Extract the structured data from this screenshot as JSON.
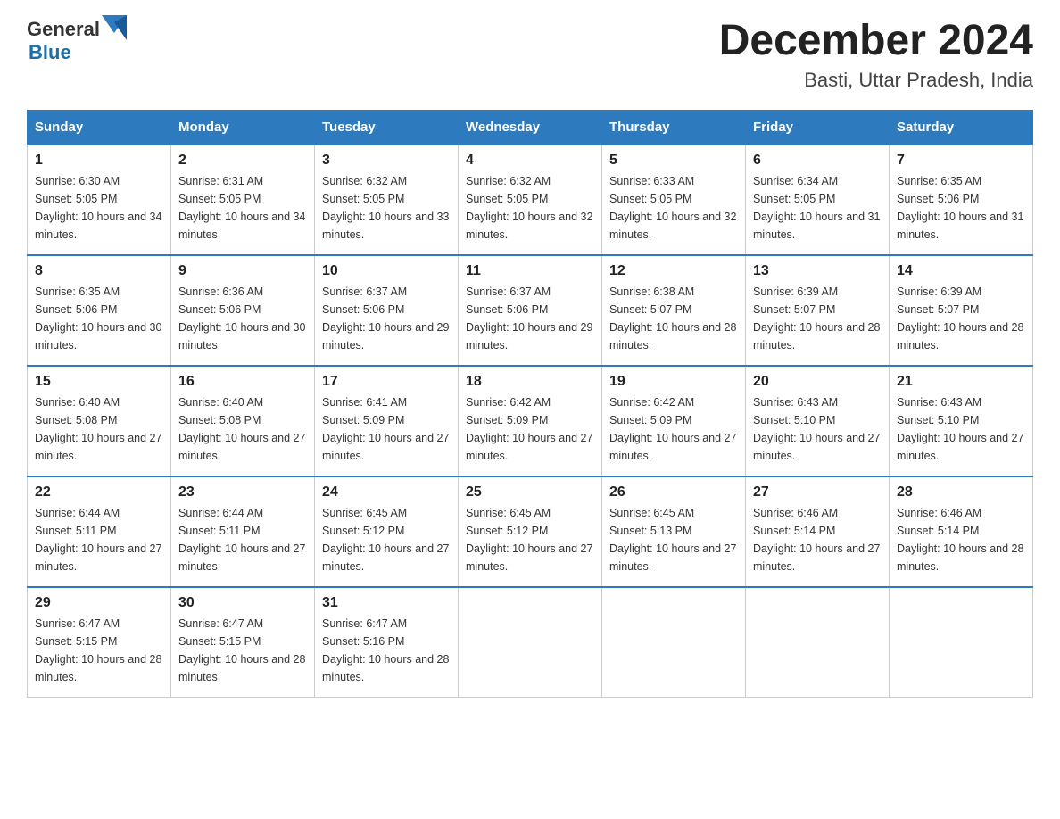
{
  "header": {
    "logo_general": "General",
    "logo_blue": "Blue",
    "title": "December 2024",
    "subtitle": "Basti, Uttar Pradesh, India"
  },
  "calendar": {
    "weekdays": [
      "Sunday",
      "Monday",
      "Tuesday",
      "Wednesday",
      "Thursday",
      "Friday",
      "Saturday"
    ],
    "weeks": [
      [
        {
          "day": "1",
          "sunrise": "6:30 AM",
          "sunset": "5:05 PM",
          "daylight": "10 hours and 34 minutes."
        },
        {
          "day": "2",
          "sunrise": "6:31 AM",
          "sunset": "5:05 PM",
          "daylight": "10 hours and 34 minutes."
        },
        {
          "day": "3",
          "sunrise": "6:32 AM",
          "sunset": "5:05 PM",
          "daylight": "10 hours and 33 minutes."
        },
        {
          "day": "4",
          "sunrise": "6:32 AM",
          "sunset": "5:05 PM",
          "daylight": "10 hours and 32 minutes."
        },
        {
          "day": "5",
          "sunrise": "6:33 AM",
          "sunset": "5:05 PM",
          "daylight": "10 hours and 32 minutes."
        },
        {
          "day": "6",
          "sunrise": "6:34 AM",
          "sunset": "5:05 PM",
          "daylight": "10 hours and 31 minutes."
        },
        {
          "day": "7",
          "sunrise": "6:35 AM",
          "sunset": "5:06 PM",
          "daylight": "10 hours and 31 minutes."
        }
      ],
      [
        {
          "day": "8",
          "sunrise": "6:35 AM",
          "sunset": "5:06 PM",
          "daylight": "10 hours and 30 minutes."
        },
        {
          "day": "9",
          "sunrise": "6:36 AM",
          "sunset": "5:06 PM",
          "daylight": "10 hours and 30 minutes."
        },
        {
          "day": "10",
          "sunrise": "6:37 AM",
          "sunset": "5:06 PM",
          "daylight": "10 hours and 29 minutes."
        },
        {
          "day": "11",
          "sunrise": "6:37 AM",
          "sunset": "5:06 PM",
          "daylight": "10 hours and 29 minutes."
        },
        {
          "day": "12",
          "sunrise": "6:38 AM",
          "sunset": "5:07 PM",
          "daylight": "10 hours and 28 minutes."
        },
        {
          "day": "13",
          "sunrise": "6:39 AM",
          "sunset": "5:07 PM",
          "daylight": "10 hours and 28 minutes."
        },
        {
          "day": "14",
          "sunrise": "6:39 AM",
          "sunset": "5:07 PM",
          "daylight": "10 hours and 28 minutes."
        }
      ],
      [
        {
          "day": "15",
          "sunrise": "6:40 AM",
          "sunset": "5:08 PM",
          "daylight": "10 hours and 27 minutes."
        },
        {
          "day": "16",
          "sunrise": "6:40 AM",
          "sunset": "5:08 PM",
          "daylight": "10 hours and 27 minutes."
        },
        {
          "day": "17",
          "sunrise": "6:41 AM",
          "sunset": "5:09 PM",
          "daylight": "10 hours and 27 minutes."
        },
        {
          "day": "18",
          "sunrise": "6:42 AM",
          "sunset": "5:09 PM",
          "daylight": "10 hours and 27 minutes."
        },
        {
          "day": "19",
          "sunrise": "6:42 AM",
          "sunset": "5:09 PM",
          "daylight": "10 hours and 27 minutes."
        },
        {
          "day": "20",
          "sunrise": "6:43 AM",
          "sunset": "5:10 PM",
          "daylight": "10 hours and 27 minutes."
        },
        {
          "day": "21",
          "sunrise": "6:43 AM",
          "sunset": "5:10 PM",
          "daylight": "10 hours and 27 minutes."
        }
      ],
      [
        {
          "day": "22",
          "sunrise": "6:44 AM",
          "sunset": "5:11 PM",
          "daylight": "10 hours and 27 minutes."
        },
        {
          "day": "23",
          "sunrise": "6:44 AM",
          "sunset": "5:11 PM",
          "daylight": "10 hours and 27 minutes."
        },
        {
          "day": "24",
          "sunrise": "6:45 AM",
          "sunset": "5:12 PM",
          "daylight": "10 hours and 27 minutes."
        },
        {
          "day": "25",
          "sunrise": "6:45 AM",
          "sunset": "5:12 PM",
          "daylight": "10 hours and 27 minutes."
        },
        {
          "day": "26",
          "sunrise": "6:45 AM",
          "sunset": "5:13 PM",
          "daylight": "10 hours and 27 minutes."
        },
        {
          "day": "27",
          "sunrise": "6:46 AM",
          "sunset": "5:14 PM",
          "daylight": "10 hours and 27 minutes."
        },
        {
          "day": "28",
          "sunrise": "6:46 AM",
          "sunset": "5:14 PM",
          "daylight": "10 hours and 28 minutes."
        }
      ],
      [
        {
          "day": "29",
          "sunrise": "6:47 AM",
          "sunset": "5:15 PM",
          "daylight": "10 hours and 28 minutes."
        },
        {
          "day": "30",
          "sunrise": "6:47 AM",
          "sunset": "5:15 PM",
          "daylight": "10 hours and 28 minutes."
        },
        {
          "day": "31",
          "sunrise": "6:47 AM",
          "sunset": "5:16 PM",
          "daylight": "10 hours and 28 minutes."
        },
        null,
        null,
        null,
        null
      ]
    ],
    "labels": {
      "sunrise": "Sunrise: ",
      "sunset": "Sunset: ",
      "daylight": "Daylight: "
    }
  }
}
